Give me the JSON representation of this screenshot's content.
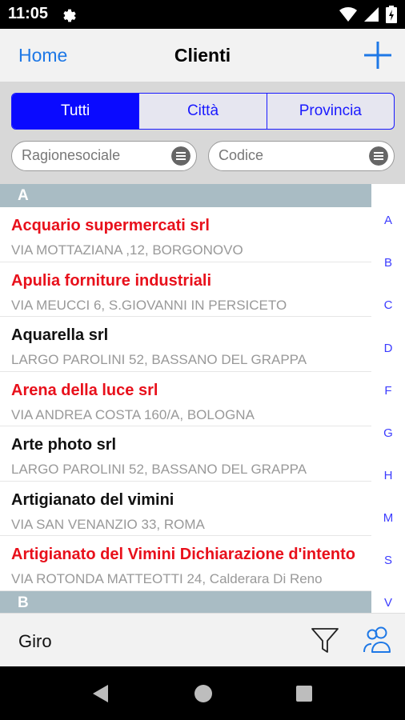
{
  "status_bar": {
    "time": "11:05"
  },
  "nav": {
    "back_label": "Home",
    "title": "Clienti"
  },
  "segments": [
    "Tutti",
    "Città",
    "Provincia"
  ],
  "search": {
    "ragione_placeholder": "Ragionesociale",
    "codice_placeholder": "Codice"
  },
  "sections": [
    {
      "letter": "A",
      "rows": [
        {
          "name": "Acquario supermercati srl",
          "address": "VIA MOTTAZIANA ,12, BORGONOVO",
          "color": "#e8101b"
        },
        {
          "name": "Apulia forniture industriali",
          "address": "VIA MEUCCI 6, S.GIOVANNI IN PERSICETO",
          "color": "#e8101b"
        },
        {
          "name": "Aquarella srl",
          "address": "LARGO PAROLINI 52, BASSANO DEL GRAPPA",
          "color": "#111111"
        },
        {
          "name": "Arena della luce srl",
          "address": "VIA ANDREA COSTA 160/A, BOLOGNA",
          "color": "#e8101b"
        },
        {
          "name": "Arte photo srl",
          "address": "LARGO PAROLINI 52, BASSANO DEL GRAPPA",
          "color": "#111111"
        },
        {
          "name": "Artigianato del vimini",
          "address": "VIA SAN VENANZIO 33, ROMA",
          "color": "#111111"
        },
        {
          "name": "Artigianato del Vimini Dichiarazione d'intento",
          "address": "VIA ROTONDA MATTEOTTI 24, Calderara Di Reno",
          "color": "#e8101b"
        }
      ]
    },
    {
      "letter": "B",
      "rows": []
    }
  ],
  "index_letters": [
    "A",
    "B",
    "C",
    "D",
    "F",
    "G",
    "H",
    "M",
    "S",
    "V"
  ],
  "toolbar": {
    "label": "Giro"
  },
  "colors": {
    "accent": "#1e78e6",
    "segment_active": "#0a0aff",
    "section_header": "#a9bcc4",
    "red": "#e8101b"
  },
  "icons": {
    "status": [
      "gear-icon",
      "wifi-icon",
      "signal-icon",
      "battery-icon"
    ],
    "nav_add": "plus-icon",
    "field_buttons": "list-icon",
    "toolbar": [
      "filter-icon",
      "people-icon"
    ]
  }
}
